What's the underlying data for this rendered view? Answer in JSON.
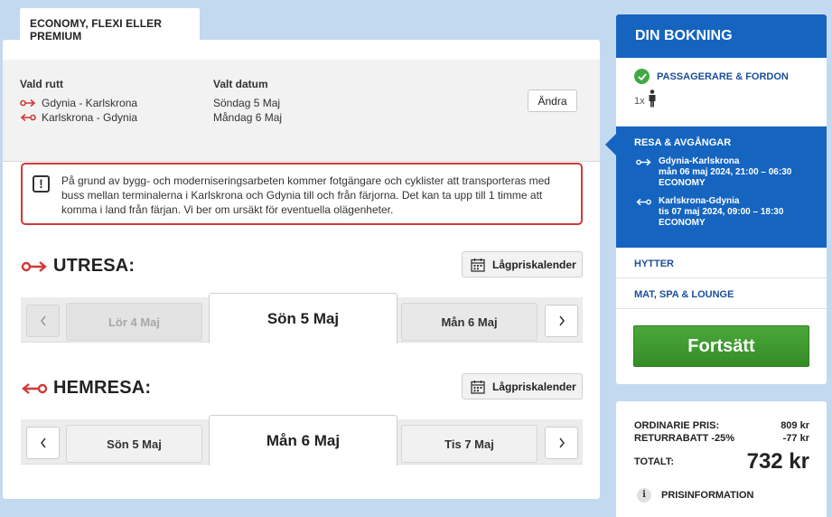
{
  "tab": {
    "label": "ECONOMY, FLEXI ELLER PREMIUM"
  },
  "route": {
    "route_header": "Vald rutt",
    "date_header": "Valt datum",
    "outbound_route": "Gdynia - Karlskrona",
    "return_route": "Karlskrona - Gdynia",
    "outbound_date": "Söndag 5 Maj",
    "return_date": "Måndag 6 Maj",
    "edit_label": "Ändra"
  },
  "notice": {
    "text": "På grund av bygg- och moderniseringsarbeten kommer fotgängare och cyklister att transporteras med buss mellan terminalerna i Karlskrona och Gdynia till och från färjorna. Det kan ta upp till 1 timme att komma i land från färjan. Vi ber om ursäkt för eventuella olägenheter."
  },
  "outbound": {
    "title": "UTRESA:",
    "calendar_label": "Lågpriskalender",
    "prev_day": "Lör 4 Maj",
    "selected_day": "Sön 5 Maj",
    "next_day": "Mån 6 Maj"
  },
  "return": {
    "title": "HEMRESA:",
    "calendar_label": "Lågpriskalender",
    "prev_day": "Sön 5 Maj",
    "selected_day": "Mån 6 Maj",
    "next_day": "Tis 7 Maj"
  },
  "booking": {
    "title": "DIN BOKNING",
    "passengers_label": "PASSAGERARE & FORDON",
    "passenger_count": "1x",
    "travel_label": "RESA & AVGÅNGAR",
    "legs": [
      {
        "route": "Gdynia-Karlskrona",
        "time": "mån 06 maj 2024, 21:00 – 06:30",
        "class": "ECONOMY"
      },
      {
        "route": "Karlskrona-Gdynia",
        "time": "tis 07 maj 2024, 09:00 – 18:30",
        "class": "ECONOMY"
      }
    ],
    "cabins_label": "HYTTER",
    "food_label": "MAT, SPA & LOUNGE",
    "continue_label": "Fortsätt"
  },
  "price": {
    "regular_label": "ORDINARIE PRIS:",
    "regular_value": "809 kr",
    "discount_label": "RETURRABATT -25%",
    "discount_value": "-77 kr",
    "total_label": "TOTALT:",
    "total_value": "732 kr",
    "info_label": "PRISINFORMATION"
  },
  "colors": {
    "accent_blue": "#1565c0",
    "brand_red": "#d33838",
    "continue_green": "#3d9a2e",
    "check_green": "#42a844"
  },
  "icons": [
    "outbound-arrow-icon",
    "return-arrow-icon",
    "alert-icon",
    "calendar-icon",
    "chevron-left-icon",
    "chevron-right-icon",
    "check-icon",
    "person-icon",
    "info-icon"
  ]
}
